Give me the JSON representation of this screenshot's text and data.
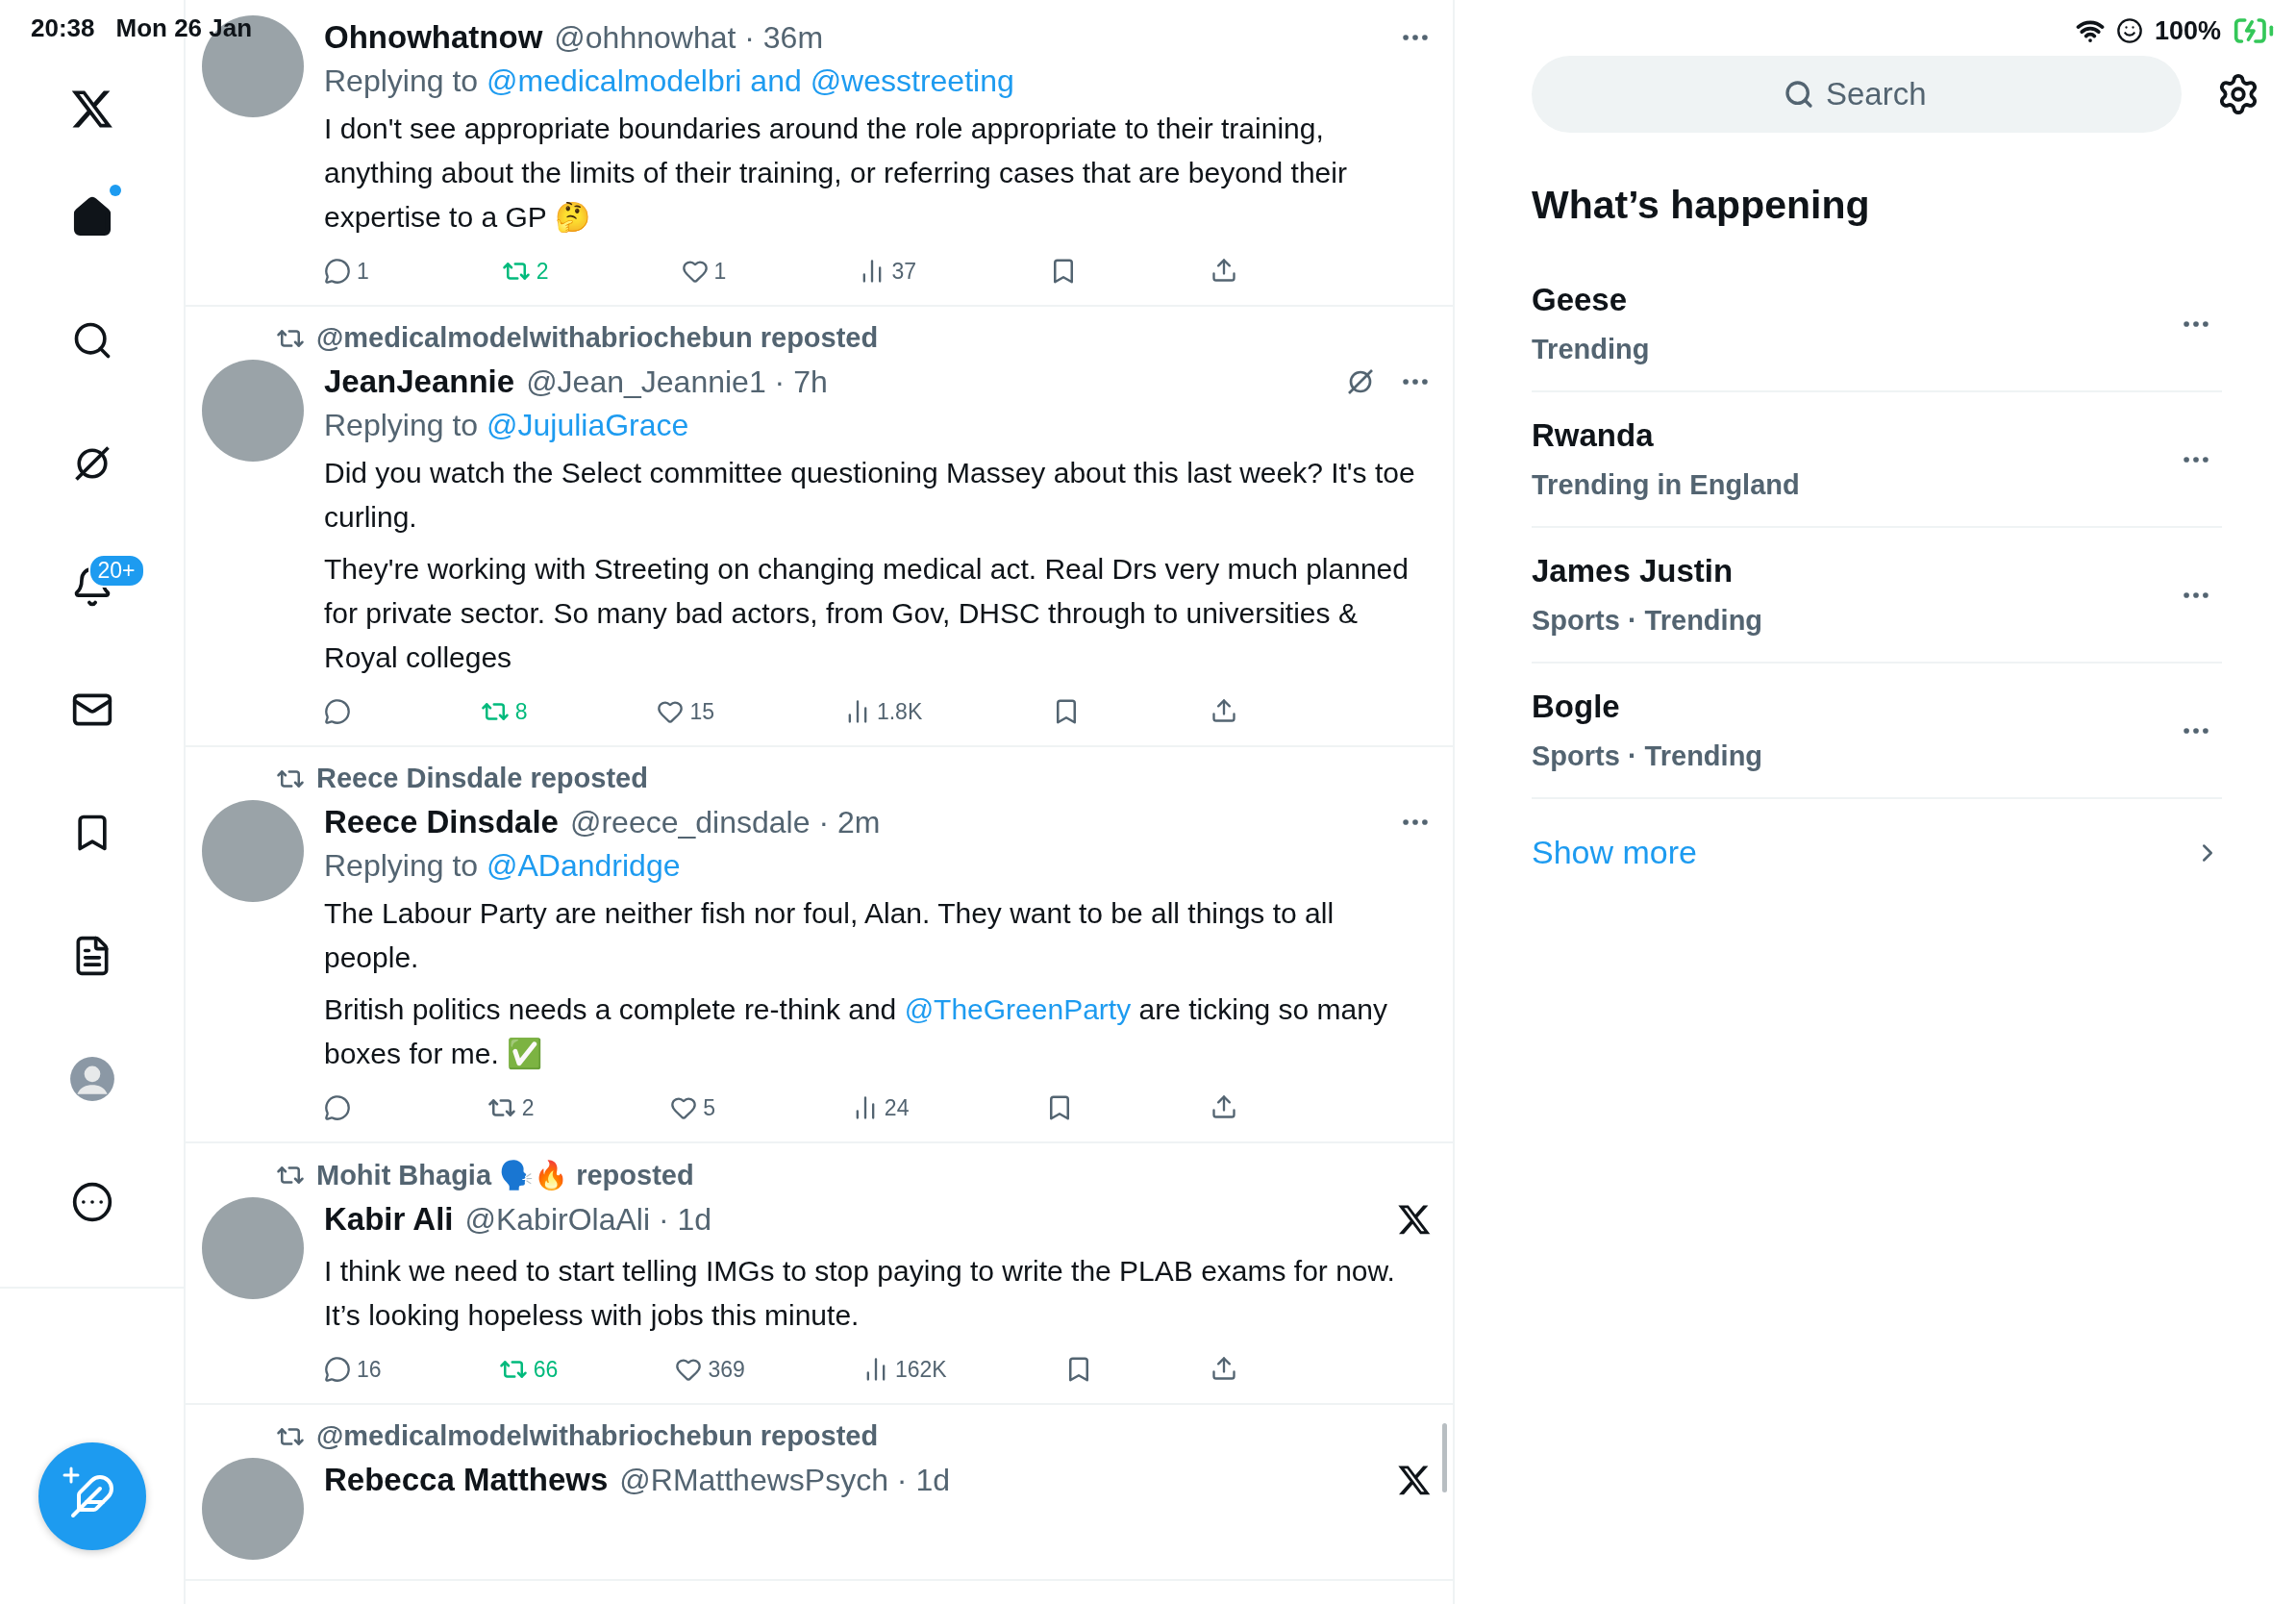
{
  "status_bar": {
    "time": "20:38",
    "date": "Mon 26 Jan",
    "battery": "100%"
  },
  "sidebar": {
    "items": [
      {
        "kind": "home",
        "selected": true,
        "unread": true
      },
      {
        "kind": "search",
        "selected": false,
        "unread": false
      },
      {
        "kind": "grok",
        "selected": false,
        "unread": false
      },
      {
        "kind": "notifications",
        "selected": false,
        "unread": false,
        "badge": "20+"
      },
      {
        "kind": "messages",
        "selected": false,
        "unread": false
      },
      {
        "kind": "bookmarks",
        "selected": false,
        "unread": false
      },
      {
        "kind": "lists",
        "selected": false,
        "unread": false
      },
      {
        "kind": "profile",
        "selected": false,
        "unread": false
      },
      {
        "kind": "more",
        "selected": false,
        "unread": false
      }
    ]
  },
  "tweets": [
    {
      "name": "Ohnowhatnow",
      "meta": "@ohhnowhat · 36m",
      "reply": {
        "label": "Replying to",
        "to": "@medicalmodelbri and @wesstreeting"
      },
      "corner": [
        {
          "kind": "more"
        }
      ],
      "body": [
        [
          {
            "kind": "text",
            "text": "I don't see appropriate boundaries around the role appropriate to their training, anything about the limits of their training, or referring cases that are beyond their expertise to a GP 🤔"
          }
        ]
      ],
      "stats": {
        "replies": "1",
        "reposts": "2",
        "reposted": true,
        "likes": "1",
        "views": "37"
      }
    },
    {
      "repost": "@medicalmodelwithabriochebun reposted",
      "name": "JeanJeannie",
      "meta": "@Jean_Jeannie1 · 7h",
      "reply": {
        "label": "Replying to",
        "to": "@JujuliaGrace"
      },
      "corner": [
        {
          "kind": "grok"
        },
        {
          "kind": "more"
        }
      ],
      "body": [
        [
          {
            "kind": "text",
            "text": "Did you watch the Select committee questioning Massey about this last week? It's toe curling."
          }
        ],
        [
          {
            "kind": "text",
            "text": "They're working with Streeting on changing medical act. Real Drs very much planned for private sector. So many bad actors, from Gov, DHSC through to universities & Royal colleges"
          }
        ]
      ],
      "stats": {
        "reposts": "8",
        "reposted": true,
        "likes": "15",
        "views": "1.8K"
      }
    },
    {
      "repost": "Reece Dinsdale reposted",
      "name": "Reece Dinsdale",
      "meta": "@reece_dinsdale · 2m",
      "reply": {
        "label": "Replying to",
        "to": "@ADandridge"
      },
      "corner": [
        {
          "kind": "more"
        }
      ],
      "body": [
        [
          {
            "kind": "text",
            "text": "The Labour Party are neither fish nor foul, Alan. They want to be all things to all people."
          }
        ],
        [
          {
            "kind": "text",
            "text": "British politics needs a complete re-think and "
          },
          {
            "kind": "mention",
            "text": "@TheGreenParty"
          },
          {
            "kind": "text",
            "text": " are ticking so many boxes for me. ✅"
          }
        ]
      ],
      "stats": {
        "reposts": "2",
        "reposted": false,
        "likes": "5",
        "views": "24"
      }
    },
    {
      "repost": "Mohit Bhagia 🗣️🔥 reposted",
      "name": "Kabir Ali",
      "meta": "@KabirOlaAli · 1d",
      "corner": [
        {
          "kind": "x"
        }
      ],
      "body": [
        [
          {
            "kind": "text",
            "text": "I think we need to start telling IMGs to stop paying to write the PLAB exams for now. It’s looking hopeless with jobs this minute."
          }
        ]
      ],
      "stats": {
        "replies": "16",
        "reposts": "66",
        "reposted": true,
        "likes": "369",
        "views": "162K"
      }
    },
    {
      "repost": "@medicalmodelwithabriochebun reposted",
      "name": "Rebecca Matthews",
      "meta": "@RMatthewsPsych · 1d",
      "corner": [
        {
          "kind": "x"
        }
      ]
    }
  ],
  "search": {
    "placeholder": "Search"
  },
  "trends_title": "What’s happening",
  "trends": [
    {
      "name": "Geese",
      "meta": "Trending"
    },
    {
      "name": "Rwanda",
      "meta": "Trending in England"
    },
    {
      "name": "James Justin",
      "meta": "Sports · Trending"
    },
    {
      "name": "Bogle",
      "meta": "Sports · Trending"
    }
  ],
  "show_more": "Show more"
}
